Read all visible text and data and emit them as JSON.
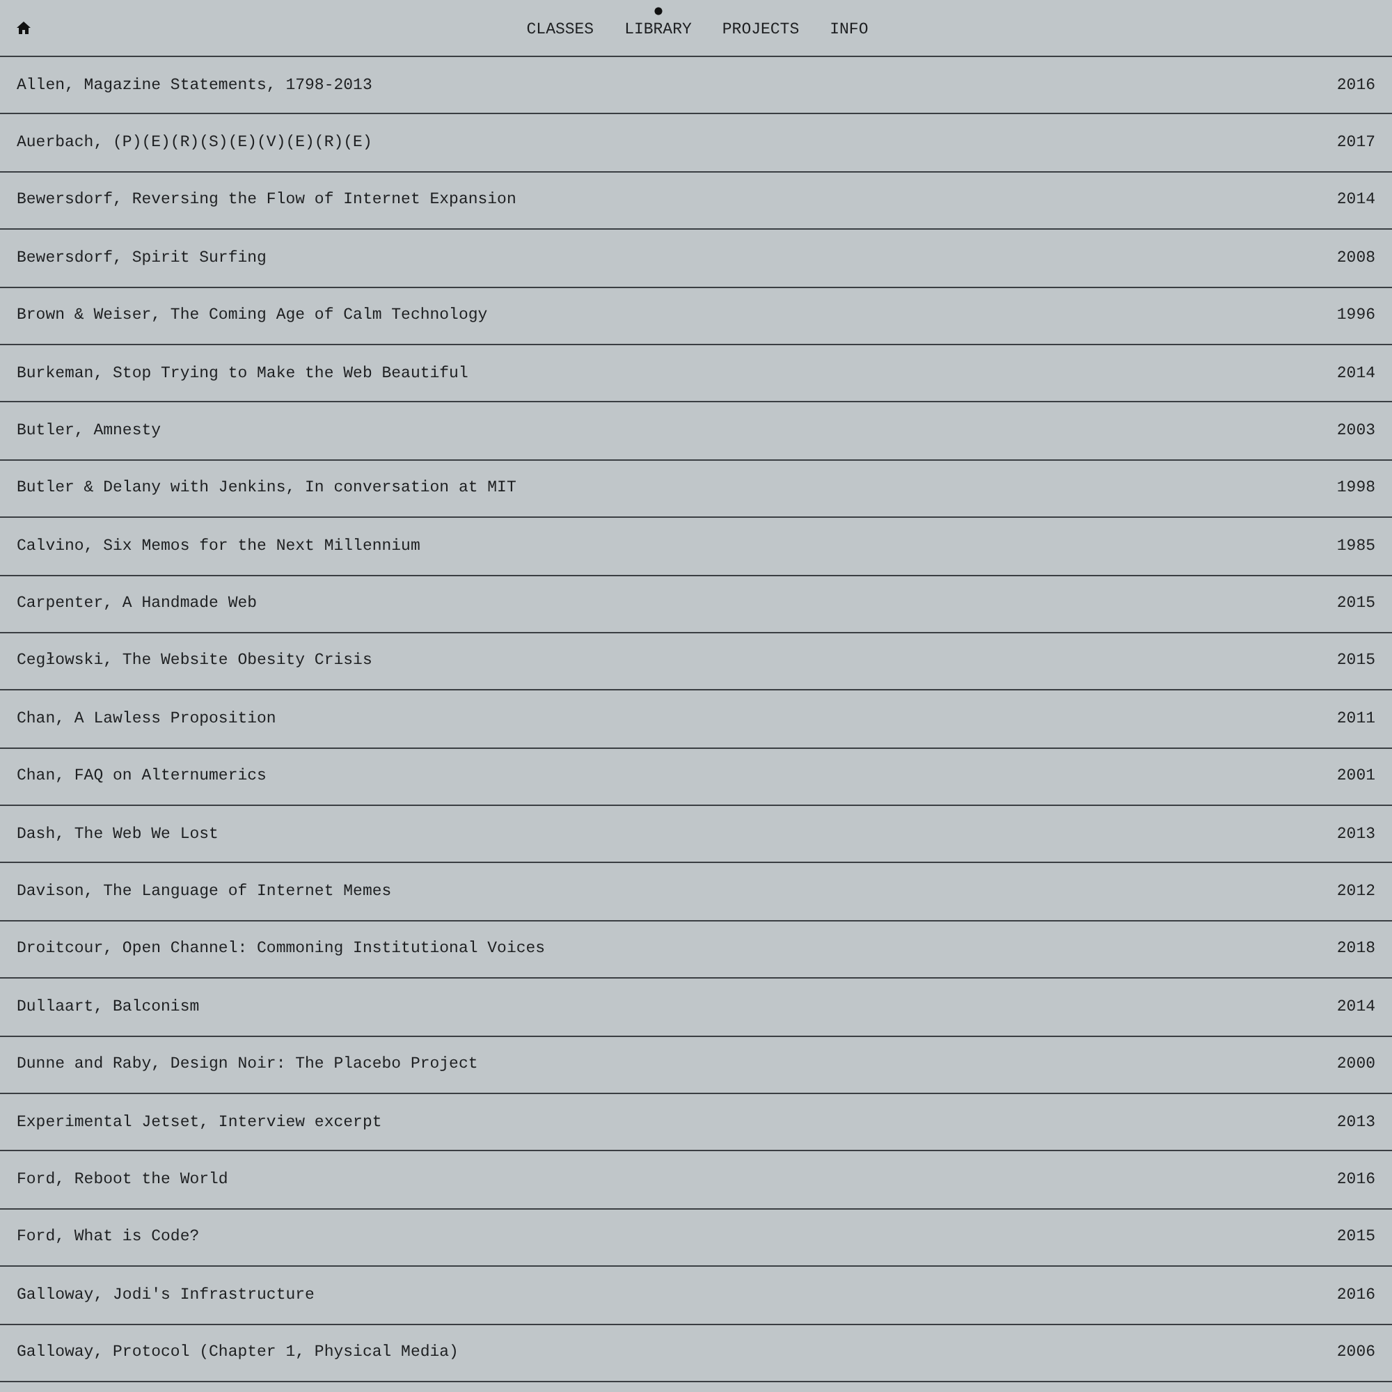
{
  "nav": [
    {
      "label": "CLASSES",
      "selected": false
    },
    {
      "label": "LIBRARY",
      "selected": true
    },
    {
      "label": "PROJECTS",
      "selected": false
    },
    {
      "label": "INFO",
      "selected": false
    }
  ],
  "library": [
    {
      "title": "Allen, Magazine Statements, 1798-2013",
      "year": "2016"
    },
    {
      "title": "Auerbach, (P)(E)(R)(S)(E)(V)(E)(R)(E)",
      "year": "2017"
    },
    {
      "title": "Bewersdorf, Reversing the Flow of Internet Expansion",
      "year": "2014"
    },
    {
      "title": "Bewersdorf, Spirit Surfing",
      "year": "2008"
    },
    {
      "title": "Brown & Weiser, The Coming Age of Calm Technology",
      "year": "1996"
    },
    {
      "title": "Burkeman, Stop Trying to Make the Web Beautiful",
      "year": "2014"
    },
    {
      "title": "Butler, Amnesty",
      "year": "2003"
    },
    {
      "title": "Butler & Delany with Jenkins, In conversation at MIT",
      "year": "1998"
    },
    {
      "title": "Calvino, Six Memos for the Next Millennium",
      "year": "1985"
    },
    {
      "title": "Carpenter, A Handmade Web",
      "year": "2015"
    },
    {
      "title": "Cegłowski, The Website Obesity Crisis",
      "year": "2015"
    },
    {
      "title": "Chan, A Lawless Proposition",
      "year": "2011"
    },
    {
      "title": "Chan, FAQ on Alternumerics",
      "year": "2001"
    },
    {
      "title": "Dash, The Web We Lost",
      "year": "2013"
    },
    {
      "title": "Davison, The Language of Internet Memes",
      "year": "2012"
    },
    {
      "title": "Droitcour, Open Channel: Commoning Institutional Voices",
      "year": "2018"
    },
    {
      "title": "Dullaart, Balconism",
      "year": "2014"
    },
    {
      "title": "Dunne and Raby, Design Noir: The Placebo Project",
      "year": "2000"
    },
    {
      "title": "Experimental Jetset, Interview excerpt",
      "year": "2013"
    },
    {
      "title": "Ford, Reboot the World",
      "year": "2016"
    },
    {
      "title": "Ford, What is Code?",
      "year": "2015"
    },
    {
      "title": "Galloway, Jodi's Infrastructure",
      "year": "2016"
    },
    {
      "title": "Galloway, Protocol (Chapter 1, Physical Media)",
      "year": "2006"
    }
  ]
}
